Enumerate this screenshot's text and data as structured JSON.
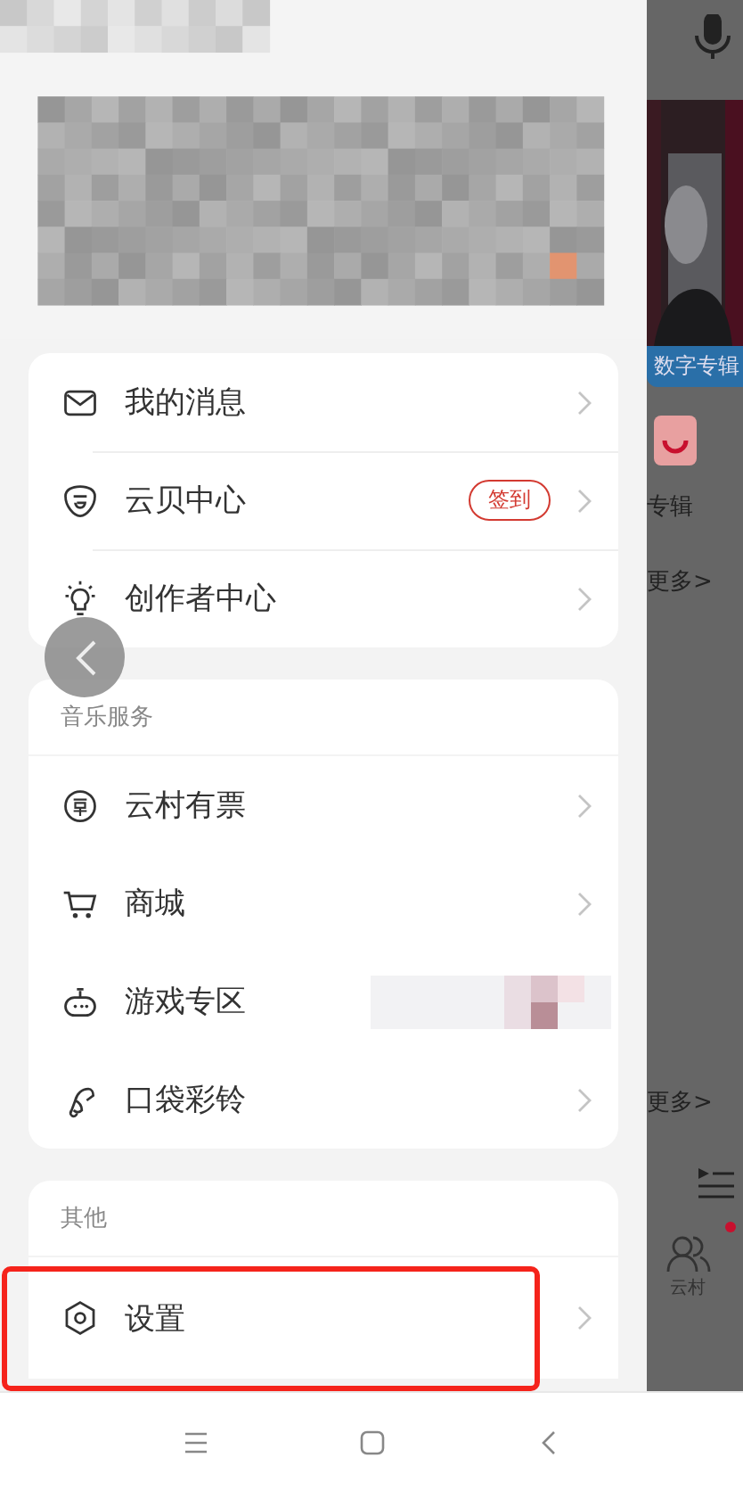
{
  "sections": [
    {
      "items": [
        {
          "label": "我的消息"
        },
        {
          "label": "云贝中心",
          "badge": "签到"
        },
        {
          "label": "创作者中心"
        }
      ]
    },
    {
      "header": "音乐服务",
      "items": [
        {
          "label": "云村有票"
        },
        {
          "label": "商城"
        },
        {
          "label": "游戏专区"
        },
        {
          "label": "口袋彩铃"
        }
      ]
    },
    {
      "header": "其他",
      "items": [
        {
          "label": "设置",
          "highlighted": true
        }
      ]
    }
  ],
  "background_page": {
    "tag": "数字专辑",
    "album_label": "专辑",
    "more_links": [
      "更多>",
      "更多>"
    ],
    "tab_label": "云村",
    "notification_dot": true
  }
}
